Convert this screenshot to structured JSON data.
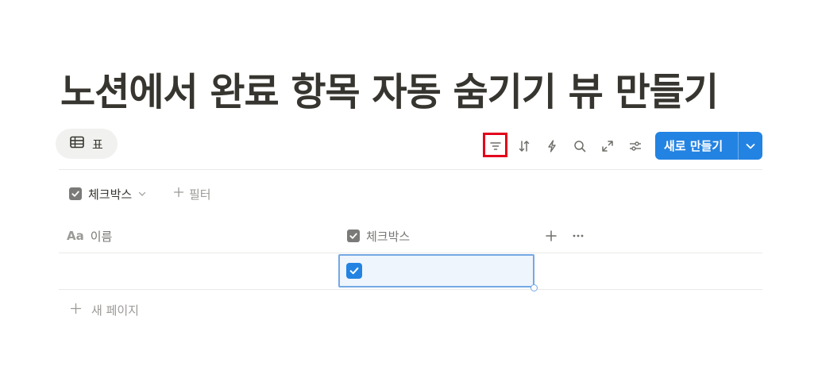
{
  "page": {
    "title": "노션에서 완료 항목 자동 숨기기 뷰 만들기"
  },
  "view_tab": {
    "label": "표",
    "icon": "table-icon"
  },
  "toolbar": {
    "icons": [
      "filter-icon",
      "sort-icon",
      "automation-bolt-icon",
      "search-icon",
      "expand-icon",
      "settings-sliders-icon"
    ],
    "highlighted": "filter-icon",
    "highlight_color": "#e3001b",
    "new_button_label": "새로 만들기",
    "new_button_color": "#2383e2"
  },
  "filter_bar": {
    "active_filter_label": "체크박스",
    "add_filter_label": "필터"
  },
  "table": {
    "columns": [
      {
        "label": "이름",
        "type_icon": "Aa"
      },
      {
        "label": "체크박스",
        "type_icon": "checkbox-icon"
      }
    ],
    "rows": [
      {
        "name": "",
        "checked": true
      }
    ],
    "new_row_label": "새 페이지"
  }
}
